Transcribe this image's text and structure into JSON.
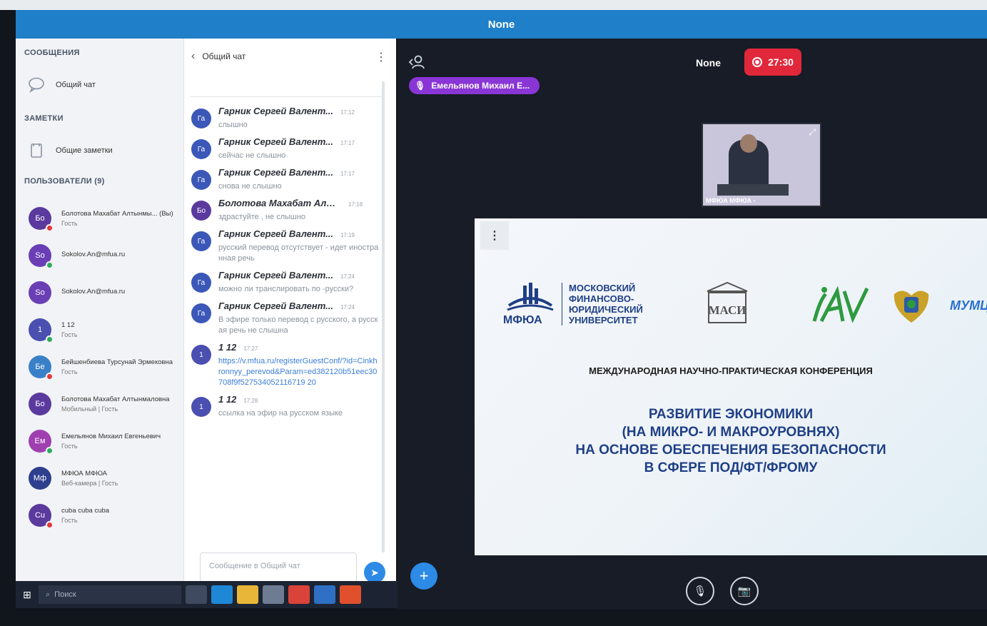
{
  "window": {
    "title": "None"
  },
  "sidebar": {
    "messages_title": "СООБЩЕНИЯ",
    "general_chat": "Общий чат",
    "notes_title": "ЗАМЕТКИ",
    "shared_notes": "Общие заметки",
    "users_title": "ПОЛЬЗОВАТЕЛИ (9)",
    "users": [
      {
        "initials": "Бо",
        "name": "Болотова Махабат Алтынмы... (Вы)",
        "role": "Гость",
        "color": "#5b3a9e",
        "dot": "#e53935"
      },
      {
        "initials": "So",
        "name": "Sokolov.An@mfua.ru",
        "role": "",
        "color": "#6a3fb5",
        "dot": "#2eaa5b"
      },
      {
        "initials": "So",
        "name": "Sokolov.An@mfua.ru",
        "role": "",
        "color": "#6a3fb5",
        "dot": ""
      },
      {
        "initials": "1",
        "name": "1 12",
        "role": "Гость",
        "color": "#4a4fb0",
        "dot": "#2eaa5b"
      },
      {
        "initials": "Бе",
        "name": "Бейшенбиева Турсунай Эрмековна",
        "role": "Гость",
        "color": "#3a80c9",
        "dot": "#e53935"
      },
      {
        "initials": "Бо",
        "name": "Болотова Махабат Алтынмаловна",
        "role": "Мобильный | Гость",
        "color": "#5b3a9e",
        "dot": ""
      },
      {
        "initials": "Ем",
        "name": "Емельянов Михаил Евгеньевич",
        "role": "Гость",
        "color": "#a03fb0",
        "dot": "#2eaa5b"
      },
      {
        "initials": "Мф",
        "name": "МФЮА МФЮА",
        "role": "Веб-камера | Гость",
        "color": "#2e3f8e",
        "dot": ""
      },
      {
        "initials": "Cu",
        "name": "cuba cuba cuba",
        "role": "Гость",
        "color": "#5b3a9e",
        "dot": "#e53935"
      }
    ]
  },
  "chat": {
    "title": "Общий чат",
    "messages": [
      {
        "initials": "Га",
        "author": "Гарник Сергей Валент...",
        "time": "17:12",
        "text": "слышно",
        "color": "#3b58b8"
      },
      {
        "initials": "Га",
        "author": "Гарник Сергей Валент...",
        "time": "17:17",
        "text": "сейчас не слышно",
        "color": "#3b58b8"
      },
      {
        "initials": "Га",
        "author": "Гарник Сергей Валент...",
        "time": "17:17",
        "text": "снова не слышно",
        "color": "#3b58b8"
      },
      {
        "initials": "Бо",
        "author": "Болотова Махабат Алт...",
        "time": "17:18",
        "text": "здрастуйте , не слышно",
        "color": "#5b3a9e"
      },
      {
        "initials": "Га",
        "author": "Гарник Сергей Валент...",
        "time": "17:19",
        "text": "русский перевод отсутствует - идет иностранная речь",
        "color": "#3b58b8"
      },
      {
        "initials": "Га",
        "author": "Гарник Сергей Валент...",
        "time": "17:24",
        "text": "можно ли транслировать по -русски?",
        "color": "#3b58b8"
      },
      {
        "initials": "Га",
        "author": "Гарник Сергей Валент...",
        "time": "17:24",
        "text": "В эфире только перевод с русского, а русская речь не слышна",
        "color": "#3b58b8"
      },
      {
        "initials": "1",
        "author": "1 12",
        "time": "17:27",
        "text": "https://v.mfua.ru/registerGuestConf/?id=Cinkhronnyy_perevod&Param=ed382120b51eec30708f9f527534052116719 20",
        "color": "#4a4fb0",
        "link": true
      },
      {
        "initials": "1",
        "author": "1 12",
        "time": "17:28",
        "text": "ссылка на эфир на русском языке",
        "color": "#4a4fb0"
      }
    ],
    "input_placeholder": "Сообщение в Общий чат"
  },
  "taskbar": {
    "search_placeholder": "Поиск"
  },
  "conference": {
    "room_name": "None",
    "recording_time": "27:30",
    "speaker": "Емельянов Михаил Е...",
    "video_label": "МФЮА МФЮА -",
    "slide": {
      "mfua_label": "МФЮА",
      "university_line1": "МОСКОВСКИЙ",
      "university_line2": "ФИНАНСОВО-",
      "university_line3": "ЮРИДИЧЕСКИЙ",
      "university_line4": "УНИВЕРСИТЕТ",
      "masi_label": "МАСИ",
      "mumts_label": "МУМЦ",
      "subtitle": "МЕЖДУНАРОДНАЯ НАУЧНО-ПРАКТИЧЕСКАЯ КОНФЕРЕНЦИЯ",
      "title_line1": "РАЗВИТИЕ ЭКОНОМИКИ",
      "title_line2": "(НА МИКРО- И МАКРОУРОВНЯХ)",
      "title_line3": "НА ОСНОВЕ ОБЕСПЕЧЕНИЯ БЕЗОПАСНОСТИ",
      "title_line4": "В СФЕРЕ ПОД/ФТ/ФРОМУ"
    }
  },
  "colors": {
    "accent": "#2d8ae6",
    "titlebar": "#1f7fc8",
    "record": "#e0283a",
    "speaker_pill": "#8a36d6",
    "brand_blue": "#1f3f86"
  }
}
